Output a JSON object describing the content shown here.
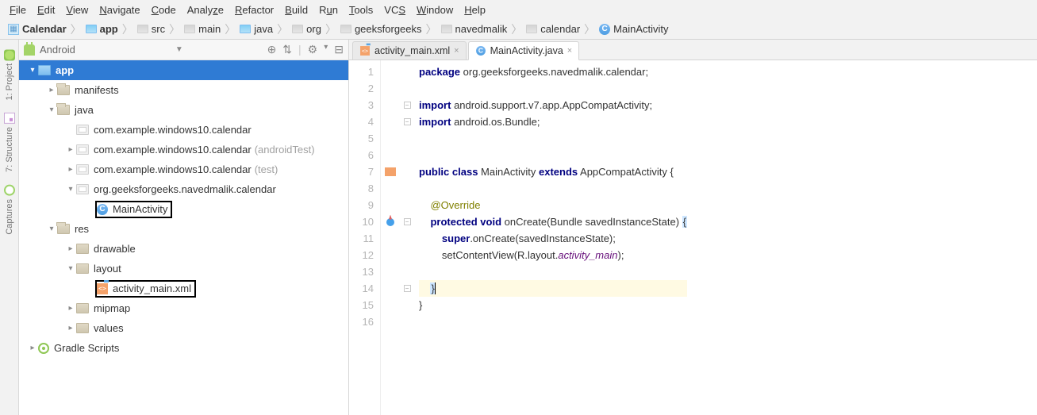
{
  "menu": [
    "File",
    "Edit",
    "View",
    "Navigate",
    "Code",
    "Analyze",
    "Refactor",
    "Build",
    "Run",
    "Tools",
    "VCS",
    "Window",
    "Help"
  ],
  "breadcrumb": {
    "root": "Calendar",
    "items": [
      "app",
      "src",
      "main",
      "java",
      "org",
      "geeksforgeeks",
      "navedmalik",
      "calendar",
      "MainActivity"
    ]
  },
  "side_tabs": {
    "project": "1: Project",
    "structure": "7: Structure",
    "captures": "Captures"
  },
  "project_panel": {
    "view": "Android",
    "tools": {
      "target": "⊕",
      "sort": "⇅",
      "gear": "⚙",
      "collapse": "⊟"
    }
  },
  "tree": {
    "app": "app",
    "manifests": "manifests",
    "java": "java",
    "pkg1": "com.example.windows10.calendar",
    "pkg2": "com.example.windows10.calendar",
    "pkg2_suffix": "(androidTest)",
    "pkg3": "com.example.windows10.calendar",
    "pkg3_suffix": "(test)",
    "pkg4": "org.geeksforgeeks.navedmalik.calendar",
    "main_activity": "MainActivity",
    "res": "res",
    "drawable": "drawable",
    "layout": "layout",
    "activity_main": "activity_main.xml",
    "mipmap": "mipmap",
    "values": "values",
    "gradle": "Gradle Scripts"
  },
  "tabs": {
    "t1": "activity_main.xml",
    "t2": "MainActivity.java"
  },
  "gutter": [
    "1",
    "2",
    "3",
    "4",
    "5",
    "6",
    "7",
    "8",
    "9",
    "10",
    "11",
    "12",
    "13",
    "14",
    "15",
    "16"
  ],
  "code": {
    "l1_a": "package",
    "l1_b": " org.geeksforgeeks.navedmalik.calendar;",
    "l3_a": "import",
    "l3_b": " android.support.v7.app.AppCompatActivity;",
    "l4_a": "import",
    "l4_b": " android.os.Bundle;",
    "l7_a": "public class",
    "l7_b": " MainActivity ",
    "l7_c": "extends",
    "l7_d": " AppCompatActivity {",
    "l9": "@Override",
    "l10_a": "protected void",
    "l10_b": " onCreate(Bundle savedInstanceState) ",
    "l10_c": "{",
    "l11_a": "super",
    "l11_b": ".onCreate(savedInstanceState);",
    "l12_a": "        setContentView(R.layout.",
    "l12_b": "activity_main",
    "l12_c": ");",
    "l14": "}",
    "l15": "}"
  }
}
